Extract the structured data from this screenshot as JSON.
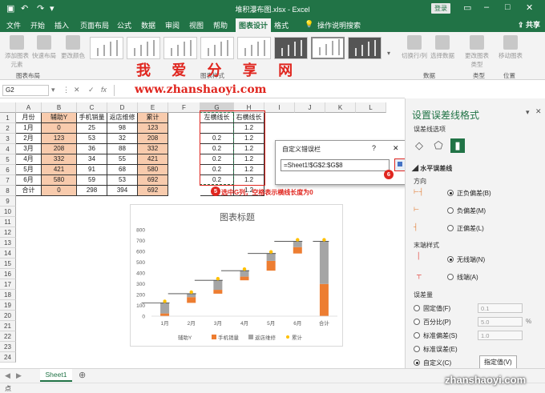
{
  "titlebar": {
    "filename": "堆积瀑布图.xlsx - Excel",
    "login": "登录"
  },
  "tabs": [
    "文件",
    "开始",
    "插入",
    "页面布局",
    "公式",
    "数据",
    "审阅",
    "视图",
    "帮助",
    "图表设计",
    "格式",
    "操作说明搜索"
  ],
  "share": "共享",
  "ribbon": {
    "add_element": "添加图表元素",
    "quick_layout": "快速布局",
    "change_color": "更改颜色",
    "styles_group": "图表样式",
    "layout_group": "图表布局",
    "switch_rowcol": "切换行/列",
    "select_data": "选择数据",
    "data_group": "数据",
    "change_type": "更改图表类型",
    "type_group": "类型",
    "move_chart": "移动图表",
    "location_group": "位置"
  },
  "watermark": {
    "line1": "我 爱 分 享 网",
    "line2": "www.zhanshaoyi.com",
    "corner": "zhanshaoyi.com"
  },
  "formula": {
    "namebox": "G2",
    "fx": "fx"
  },
  "columns": [
    "A",
    "B",
    "C",
    "D",
    "E",
    "F",
    "G",
    "H",
    "I",
    "J",
    "K",
    "L"
  ],
  "rows": [
    "1",
    "2",
    "3",
    "4",
    "5",
    "6",
    "7",
    "8",
    "9",
    "10",
    "11",
    "12",
    "13",
    "14",
    "15",
    "16",
    "17",
    "18",
    "19",
    "20",
    "21",
    "22",
    "23",
    "24"
  ],
  "table": {
    "headers": [
      "月份",
      "辅助Y",
      "手机销量",
      "返店维修",
      "累计"
    ],
    "rows": [
      [
        "1月",
        "0",
        "25",
        "98",
        "123"
      ],
      [
        "2月",
        "123",
        "53",
        "32",
        "208"
      ],
      [
        "3月",
        "208",
        "36",
        "88",
        "332"
      ],
      [
        "4月",
        "332",
        "34",
        "55",
        "421"
      ],
      [
        "5月",
        "421",
        "91",
        "68",
        "580"
      ],
      [
        "6月",
        "580",
        "59",
        "53",
        "692"
      ],
      [
        "合计",
        "0",
        "298",
        "394",
        "692"
      ]
    ]
  },
  "gh": {
    "g_header": "左横线长",
    "h_header": "右横线长",
    "g_values": [
      "",
      "0.2",
      "0.2",
      "0.2",
      "0.2",
      "0.2",
      ""
    ],
    "h_values": [
      "1.2",
      "1.2",
      "1.2",
      "1.2",
      "1.2",
      "1.2",
      "1.2"
    ]
  },
  "dialog": {
    "title": "自定义错误栏",
    "help": "?",
    "close": "✕",
    "ref": "=Sheet1!$G$2:$G$8"
  },
  "badges": {
    "b5": "5",
    "b6": "6"
  },
  "note": "选中G列，空格表示横线长度为0",
  "panel": {
    "title": "设置误差线格式",
    "options": "误差线选项",
    "section": "水平误差线",
    "direction": "方向",
    "dir_both": "正负偏差(B)",
    "dir_minus": "负偏差(M)",
    "dir_plus": "正偏差(L)",
    "end_style": "末端样式",
    "no_cap": "无线端(N)",
    "cap": "线端(A)",
    "amount": "误差量",
    "fixed": "固定值(F)",
    "fixed_val": "0.1",
    "percent": "百分比(P)",
    "percent_val": "5.0",
    "pct": "%",
    "stddev": "标准偏差(S)",
    "stddev_val": "1.0",
    "stderr": "标准误差(E)",
    "custom": "自定义(C)",
    "specify": "指定值(V)"
  },
  "sheet": {
    "tab": "Sheet1",
    "status": "点"
  },
  "colors": {
    "excel_green": "#217346",
    "orange": "#ed7d31",
    "gray": "#a5a5a5",
    "gold": "#ffc000",
    "red": "#e0261f",
    "salmon": "#f8cbad"
  },
  "chart_data": {
    "type": "bar",
    "title": "图表标题",
    "categories": [
      "1月",
      "2月",
      "3月",
      "4月",
      "5月",
      "6月",
      "合计"
    ],
    "series": [
      {
        "name": "辅助Y",
        "values": [
          0,
          123,
          208,
          332,
          421,
          580,
          0
        ]
      },
      {
        "name": "手机销量",
        "values": [
          25,
          53,
          36,
          34,
          91,
          59,
          298
        ]
      },
      {
        "name": "返店维修",
        "values": [
          98,
          32,
          88,
          55,
          68,
          53,
          394
        ]
      },
      {
        "name": "累计",
        "values": [
          123,
          208,
          332,
          421,
          580,
          692,
          692
        ]
      }
    ],
    "yticks": [
      "0",
      "100",
      "200",
      "300",
      "400",
      "500",
      "600",
      "700",
      "800"
    ],
    "ylim": [
      0,
      800
    ],
    "stacked": true,
    "grid": false,
    "legend": "bottom"
  }
}
